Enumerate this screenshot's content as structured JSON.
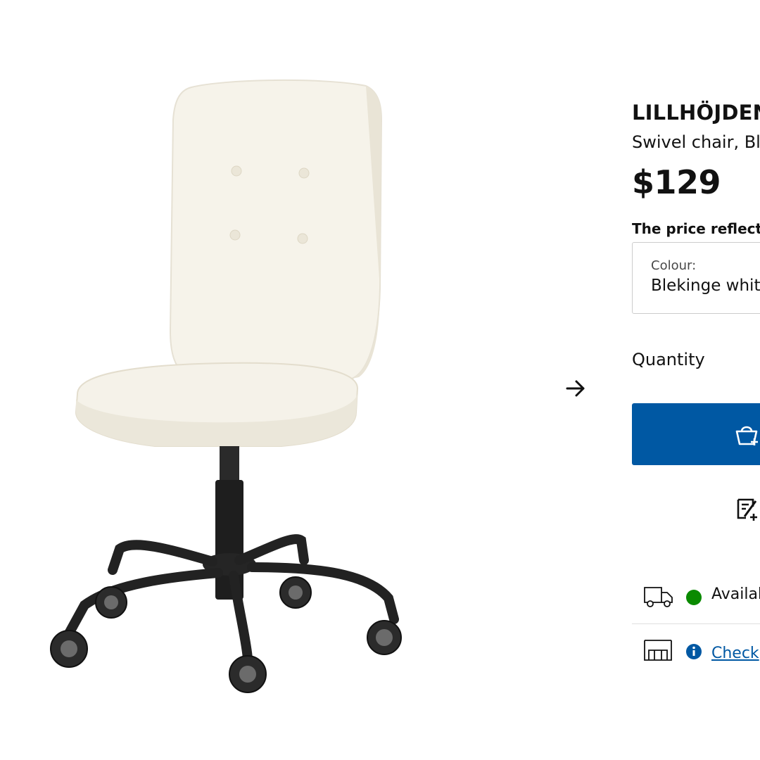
{
  "product": {
    "name": "LILLHÖJDEN",
    "description": "Swivel chair, Ble",
    "price": "$129",
    "price_note": "The price reflects"
  },
  "colour": {
    "label": "Colour:",
    "value": "Blekinge whit"
  },
  "quantity": {
    "label": "Quantity"
  },
  "availability": {
    "delivery_text": "Availab",
    "store_link_text": "Check"
  },
  "colors": {
    "primary_button": "#0058a3",
    "available_dot": "#0a8a00",
    "link": "#0058a3"
  },
  "icons": {
    "next": "arrow-right-icon",
    "bag": "shopping-bag-add-icon",
    "wishlist": "add-to-list-icon",
    "delivery": "truck-icon",
    "store": "store-icon",
    "info": "info-icon"
  }
}
